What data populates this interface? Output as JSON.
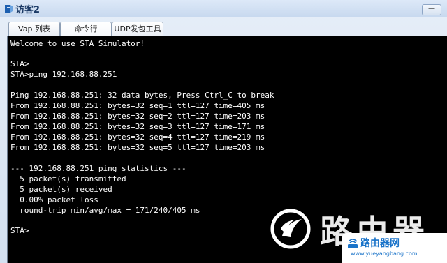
{
  "window": {
    "title": "访客2",
    "minimize_label": "—"
  },
  "tabs": [
    {
      "label": "Vap 列表"
    },
    {
      "label": "命令行"
    },
    {
      "label": "UDP发包工具"
    }
  ],
  "terminal": {
    "lines": [
      "Welcome to use STA Simulator!",
      "",
      "STA>",
      "STA>ping 192.168.88.251",
      "",
      "Ping 192.168.88.251: 32 data bytes, Press Ctrl_C to break",
      "From 192.168.88.251: bytes=32 seq=1 ttl=127 time=405 ms",
      "From 192.168.88.251: bytes=32 seq=2 ttl=127 time=203 ms",
      "From 192.168.88.251: bytes=32 seq=3 ttl=127 time=171 ms",
      "From 192.168.88.251: bytes=32 seq=4 ttl=127 time=219 ms",
      "From 192.168.88.251: bytes=32 seq=5 ttl=127 time=203 ms",
      "",
      "--- 192.168.88.251 ping statistics ---",
      "  5 packet(s) transmitted",
      "  5 packet(s) received",
      "  0.00% packet loss",
      "  round-trip min/avg/max = 171/240/405 ms",
      "",
      "STA>"
    ]
  },
  "watermark": {
    "big_text": "路由器",
    "badge_title": "路由器网",
    "badge_url": "www.yueyangbang.com"
  },
  "colors": {
    "terminal_bg": "#000000",
    "terminal_fg": "#ffffff",
    "brand_blue": "#1a73c9"
  }
}
